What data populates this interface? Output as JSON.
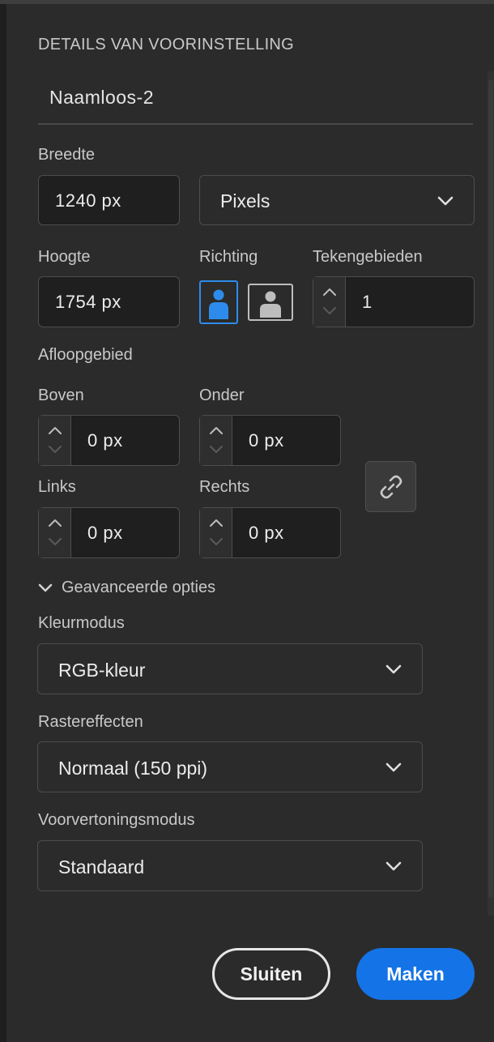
{
  "panel": {
    "section_title": "DETAILS VAN VOORINSTELLING",
    "preset_name": "Naamloos-2"
  },
  "size": {
    "width_label": "Breedte",
    "width_value": "1240 px",
    "unit_value": "Pixels",
    "height_label": "Hoogte",
    "height_value": "1754 px",
    "orientation_label": "Richting",
    "orientation_selected": "portrait",
    "artboards_label": "Tekengebieden",
    "artboards_value": "1"
  },
  "bleed": {
    "title": "Afloopgebied",
    "top_label": "Boven",
    "top_value": "0 px",
    "bottom_label": "Onder",
    "bottom_value": "0 px",
    "left_label": "Links",
    "left_value": "0 px",
    "right_label": "Rechts",
    "right_value": "0 px",
    "link_icon": "link-icon"
  },
  "advanced": {
    "toggle_label": "Geavanceerde opties",
    "color_mode_label": "Kleurmodus",
    "color_mode_value": "RGB-kleur",
    "raster_label": "Rastereffecten",
    "raster_value": "Normaal (150 ppi)",
    "preview_label": "Voorvertoningsmodus",
    "preview_value": "Standaard"
  },
  "actions": {
    "close_label": "Sluiten",
    "make_label": "Maken"
  },
  "colors": {
    "background": "#2b2b2b",
    "accent": "#1473e6",
    "field": "#1f1f1f"
  }
}
